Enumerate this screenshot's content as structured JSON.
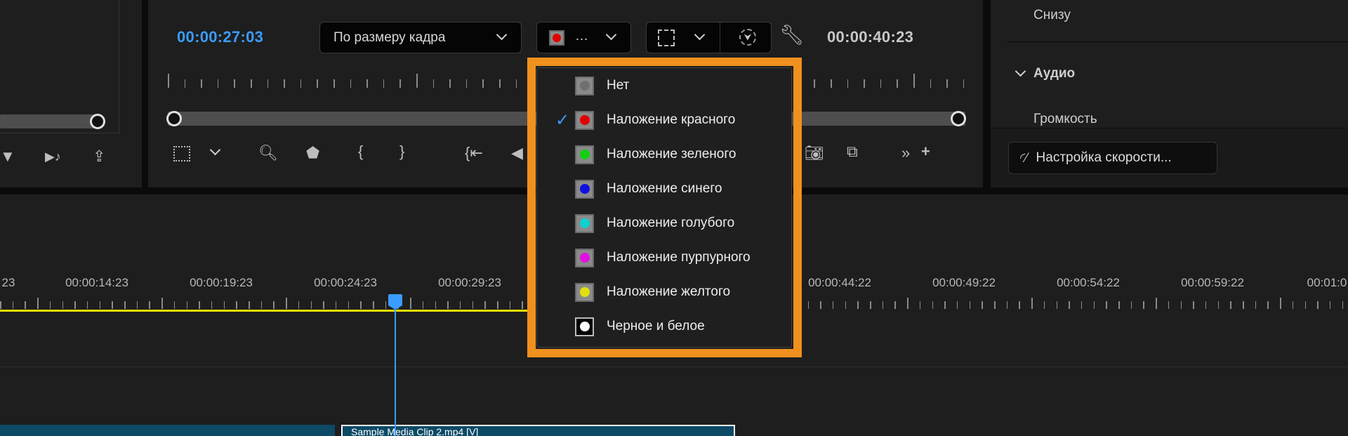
{
  "source_monitor": {
    "icons": [
      "filter-icon",
      "audio-output-icon",
      "export-icon"
    ]
  },
  "program_monitor": {
    "current_timecode": "00:00:27:03",
    "duration_timecode": "00:00:40:23",
    "zoom_select": {
      "value": "По размеру кадра"
    },
    "overlay_select": {
      "value": "…",
      "swatch_color": "#e00000"
    },
    "colors": {
      "accent": "#3b9cff",
      "highlight": "#f0901e"
    }
  },
  "overlay_menu": {
    "items": [
      {
        "label": "Нет",
        "color": "#707070",
        "checked": false
      },
      {
        "label": "Наложение красного",
        "color": "#e00000",
        "checked": true
      },
      {
        "label": "Наложение зеленого",
        "color": "#10d010",
        "checked": false
      },
      {
        "label": "Наложение синего",
        "color": "#1010e0",
        "checked": false
      },
      {
        "label": "Наложение голубого",
        "color": "#10d0d0",
        "checked": false
      },
      {
        "label": "Наложение пурпурного",
        "color": "#e010e0",
        "checked": false
      },
      {
        "label": "Наложение желтого",
        "color": "#e0e010",
        "checked": false
      },
      {
        "label": "Черное и белое",
        "color": "#ffffff",
        "checked": false
      }
    ]
  },
  "effect_controls": {
    "row_bottom": "Снизу",
    "section_audio": "Аудио",
    "row_volume": "Громкость",
    "speed_button": "Настройка скорости..."
  },
  "timeline": {
    "ruler_labels": [
      "23",
      "00:00:14:23",
      "00:00:19:23",
      "00:00:24:23",
      "00:00:29:23",
      "00:00:44:22",
      "00:00:49:22",
      "00:00:54:22",
      "00:00:59:22",
      "00:01:0"
    ],
    "clip_name": "Sample Media Clip 2.mp4 [V]"
  }
}
